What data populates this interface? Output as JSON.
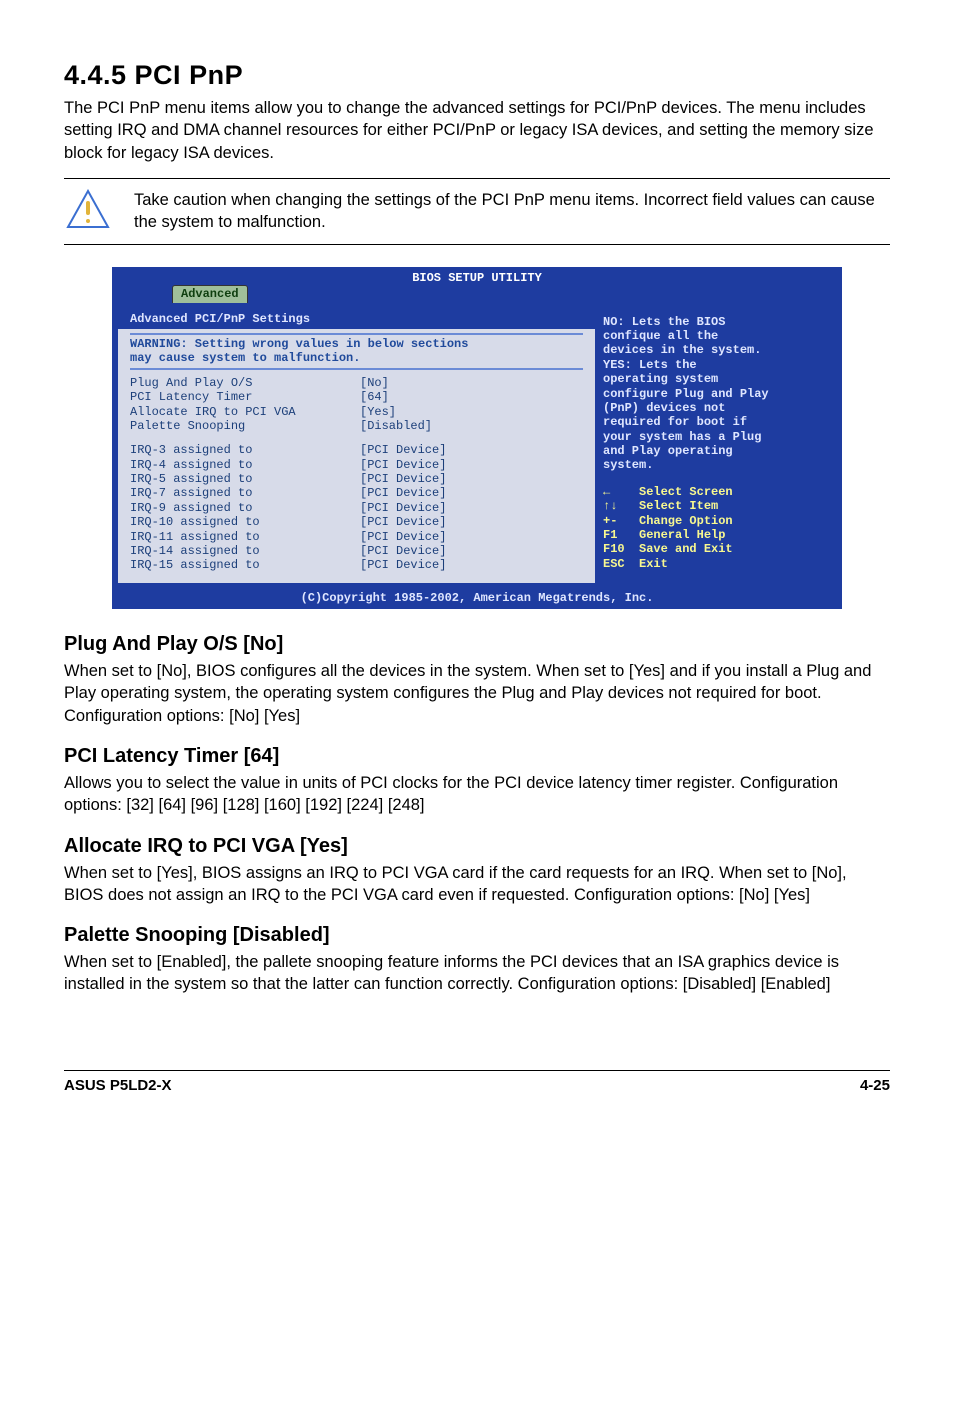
{
  "section": {
    "number_title": "4.4.5   PCI PnP",
    "intro": "The PCI PnP menu items allow you to change the advanced settings for PCI/PnP devices. The menu includes setting IRQ and DMA channel resources for either PCI/PnP or legacy ISA devices, and setting the memory size block for legacy ISA devices."
  },
  "note": {
    "text": "Take caution when changing the settings of the PCI PnP menu items. Incorrect field values can cause the system to malfunction."
  },
  "bios": {
    "title": "BIOS SETUP UTILITY",
    "tab": "Advanced",
    "left_title": "Advanced PCI/PnP Settings",
    "warning_l1": "WARNING: Setting wrong values in below sections",
    "warning_l2": "         may cause system to malfunction.",
    "rows": [
      {
        "k": "Plug And Play O/S",
        "v": "[No]"
      },
      {
        "k": "PCI Latency Timer",
        "v": "[64]"
      },
      {
        "k": "Allocate IRQ to PCI VGA",
        "v": "[Yes]"
      },
      {
        "k": "Palette Snooping",
        "v": "[Disabled]"
      }
    ],
    "irq_rows": [
      {
        "k": "IRQ-3 assigned to",
        "v": "[PCI Device]"
      },
      {
        "k": "IRQ-4 assigned to",
        "v": "[PCI Device]"
      },
      {
        "k": "IRQ-5 assigned to",
        "v": "[PCI Device]"
      },
      {
        "k": "IRQ-7 assigned to",
        "v": "[PCI Device]"
      },
      {
        "k": "IRQ-9 assigned to",
        "v": "[PCI Device]"
      },
      {
        "k": "IRQ-10 assigned to",
        "v": "[PCI Device]"
      },
      {
        "k": "IRQ-11 assigned to",
        "v": "[PCI Device]"
      },
      {
        "k": "IRQ-14 assigned to",
        "v": "[PCI Device]"
      },
      {
        "k": "IRQ-15 assigned to",
        "v": "[PCI Device]"
      }
    ],
    "help": [
      "NO: Lets the BIOS",
      "confique all the",
      "devices in the system.",
      "YES: Lets the",
      "operating system",
      "configure Plug and Play",
      "(PnP) devices not",
      "required for boot if",
      "your system has a Plug",
      "and Play operating",
      "system."
    ],
    "nav": [
      "←    Select Screen",
      "↑↓   Select Item",
      "+-   Change Option",
      "F1   General Help",
      "F10  Save and Exit",
      "ESC  Exit"
    ],
    "copyright": "(C)Copyright 1985-2002, American Megatrends, Inc."
  },
  "items": {
    "plug": {
      "h": "Plug And Play O/S [No]",
      "p": "When set to [No], BIOS configures all the devices in the system. When set to [Yes] and if you install a Plug and Play operating system, the operating system configures the Plug and Play devices not required for boot. Configuration options: [No] [Yes]"
    },
    "latency": {
      "h": "PCI Latency Timer [64]",
      "p": "Allows you to select the value in units of PCI clocks for the PCI device latency timer register. Configuration options: [32] [64] [96] [128] [160] [192] [224] [248]"
    },
    "irq": {
      "h": "Allocate IRQ to PCI VGA [Yes]",
      "p": "When set to [Yes], BIOS assigns an IRQ to PCI VGA card if the card requests for an IRQ. When set to [No], BIOS does not assign an IRQ to the PCI VGA card even if requested. Configuration options: [No] [Yes]"
    },
    "palette": {
      "h": "Palette Snooping [Disabled]",
      "p": "When set to [Enabled], the pallete snooping feature informs the PCI devices that an ISA graphics device is installed in the system so that the latter can function correctly. Configuration options: [Disabled] [Enabled]"
    }
  },
  "footer": {
    "left": "ASUS P5LD2-X",
    "right": "4-25"
  }
}
